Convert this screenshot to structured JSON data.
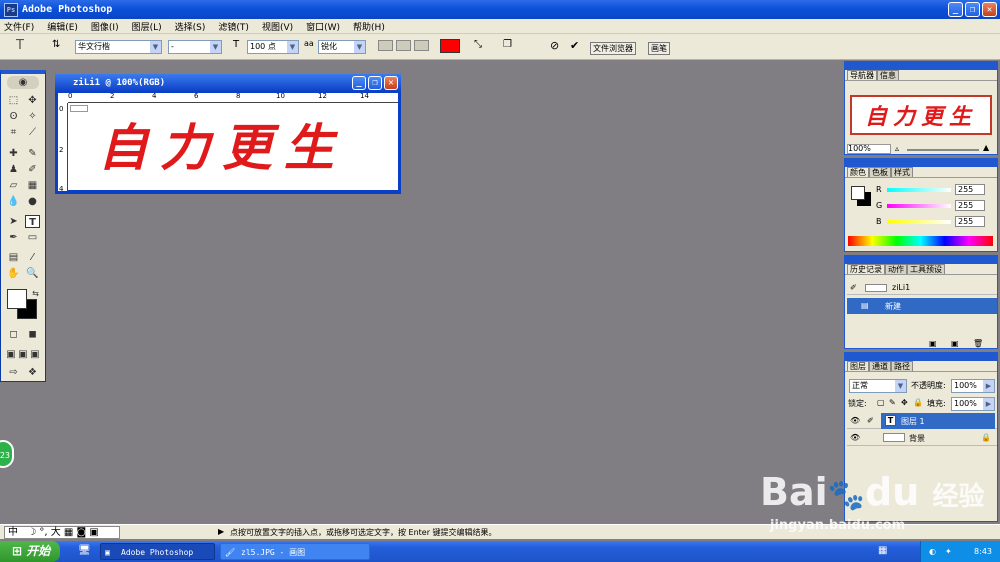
{
  "app": {
    "title": "Adobe Photoshop",
    "window_buttons": [
      "_",
      "❐",
      "✕"
    ]
  },
  "menu": [
    "文件(F)",
    "编辑(E)",
    "图像(I)",
    "图层(L)",
    "选择(S)",
    "滤镜(T)",
    "视图(V)",
    "窗口(W)",
    "帮助(H)"
  ],
  "options": {
    "font_family": "华文行楷",
    "font_style": "-",
    "font_size": "100 点",
    "aa_label": "aa",
    "antialias": "锐化",
    "color": "#ff0000",
    "tab_file_browser": "文件浏览器",
    "tab_brushes": "画笔"
  },
  "document": {
    "title": "ziLi1 @ 100%(RGB)",
    "text": "自力更生",
    "ruler_h": [
      "0",
      "2",
      "4",
      "6",
      "8",
      "10",
      "12",
      "14"
    ],
    "ruler_v": [
      "0",
      "2",
      "4"
    ]
  },
  "navigator": {
    "tabs": [
      "导航器",
      "信息"
    ],
    "preview_text": "自力更生",
    "zoom": "100%"
  },
  "color_panel": {
    "tabs": [
      "颜色",
      "色板",
      "样式"
    ],
    "r_label": "R",
    "g_label": "G",
    "b_label": "B",
    "r": "255",
    "g": "255",
    "b": "255"
  },
  "history": {
    "tabs": [
      "历史记录",
      "动作",
      "工具预设"
    ],
    "snapshot": "ziLi1",
    "items": [
      "新建"
    ]
  },
  "layers": {
    "tabs": [
      "图层",
      "通道",
      "路径"
    ],
    "blend_mode": "正常",
    "opacity_label": "不透明度:",
    "opacity": "100%",
    "lock_label": "锁定:",
    "fill_label": "填充:",
    "fill": "100%",
    "items": [
      "图层 1",
      "背景"
    ]
  },
  "status": {
    "message": "点按可放置文字的插入点，或拖移可选定文字，按 Enter 键提交编辑结果。",
    "ime": "中"
  },
  "taskbar": {
    "start": "开始",
    "tasks": [
      "Adobe Photoshop",
      "zl5.JPG - 画图"
    ],
    "clock": "8:43",
    "left_badge": "23"
  },
  "watermark": {
    "brand": "Bai",
    "brand2": "du",
    "brand_cn": "经验",
    "url": "jingyan.baidu.com"
  },
  "colors": {
    "accent": "#0a4fd8",
    "canvas_bg": "#807d83",
    "text_red": "#e01a1a"
  }
}
